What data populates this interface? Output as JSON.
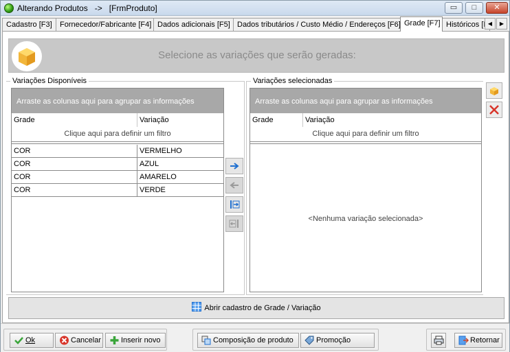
{
  "window": {
    "title": "Alterando Produtos   ->   [FrmProduto]",
    "min_glyph": "▭",
    "max_glyph": "□",
    "close_glyph": "✕"
  },
  "tabs": [
    {
      "label": "Cadastro [F3]"
    },
    {
      "label": "Fornecedor/Fabricante [F4]"
    },
    {
      "label": "Dados adicionais [F5]"
    },
    {
      "label": "Dados tributários / Custo Médio / Endereços [F6]"
    },
    {
      "label": "Grade [F7]",
      "active": true
    },
    {
      "label": "Históricos [I"
    }
  ],
  "tab_scroll": {
    "left": "◀",
    "right": "▶"
  },
  "banner": {
    "text": "Selecione as variações que serão geradas:"
  },
  "available": {
    "title": "Variações Disponíveis",
    "group_hint": "Arraste as colunas aqui para agrupar as informações",
    "col_grade": "Grade",
    "col_variacao": "Variação",
    "filter_hint": "Clique aqui para definir um filtro",
    "rows": [
      {
        "grade": "COR",
        "variacao": "VERMELHO"
      },
      {
        "grade": "COR",
        "variacao": "AZUL"
      },
      {
        "grade": "COR",
        "variacao": "AMARELO"
      },
      {
        "grade": "COR",
        "variacao": "VERDE"
      }
    ]
  },
  "selected": {
    "title": "Variações selecionadas",
    "group_hint": "Arraste as colunas aqui para agrupar as informações",
    "col_grade": "Grade",
    "col_variacao": "Variação",
    "filter_hint": "Clique aqui para definir um filtro",
    "empty": "<Nenhuma variação selecionada>"
  },
  "wide_button": {
    "label": "Abrir cadastro de Grade / Variação"
  },
  "footer": {
    "ok": "Ok",
    "cancel": "Cancelar",
    "insert": "Inserir novo",
    "composition": "Composição de produto",
    "promotion": "Promoção",
    "back": "Retornar"
  },
  "colors": {
    "accent_blue": "#1e6fd0",
    "close_red": "#c7442a",
    "ok_green": "#3aa53a",
    "cancel_red": "#d8352a"
  }
}
